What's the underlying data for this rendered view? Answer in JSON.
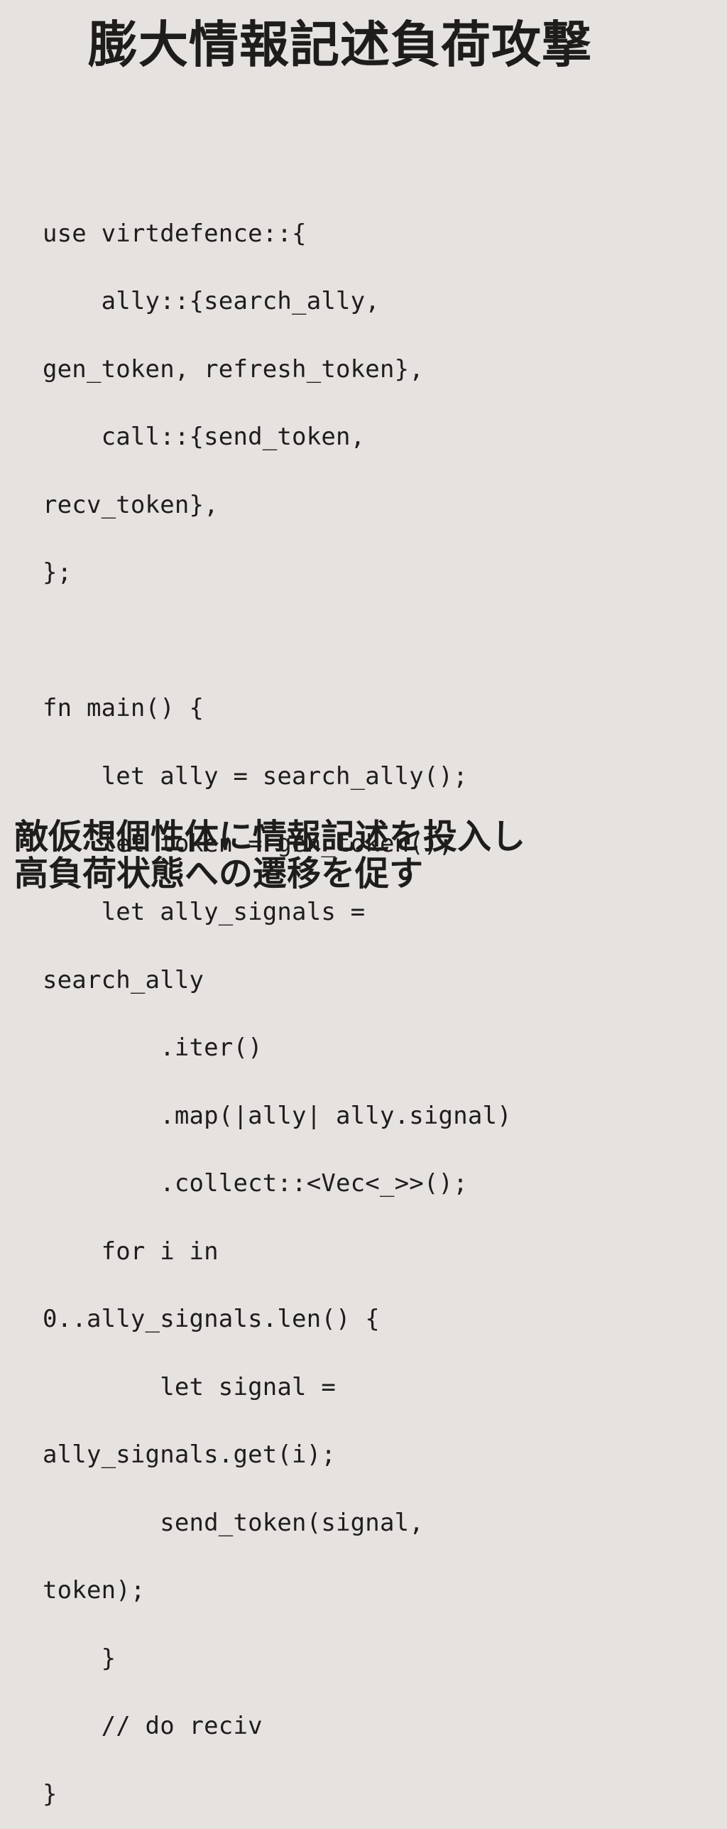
{
  "title": "膨大情報記述負荷攻撃",
  "code_lines": [
    "use virtdefence::{",
    "    ally::{search_ally,",
    "gen_token, refresh_token},",
    "    call::{send_token,",
    "recv_token},",
    "};",
    "",
    "fn main() {",
    "    let ally = search_ally();",
    "    let token = gen_token();",
    "    let ally_signals =",
    "search_ally",
    "        .iter()",
    "        .map(|ally| ally.signal)",
    "        .collect::<Vec<_>>();",
    "    for i in",
    "0..ally_signals.len() {",
    "        let signal =",
    "ally_signals.get(i);",
    "        send_token(signal,",
    "token);",
    "    }",
    "    // do reciv",
    "}"
  ],
  "caption_lines": [
    "敵仮想個性体に情報記述を投入し",
    "高負荷状態への遷移を促す"
  ]
}
